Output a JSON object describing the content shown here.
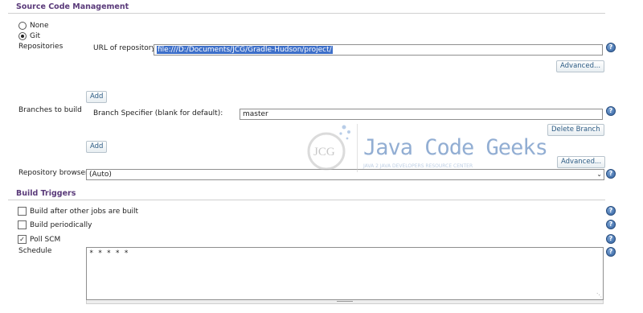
{
  "scm": {
    "title": "Source Code Management",
    "none_label": "None",
    "git_label": "Git",
    "repositories_label": "Repositories",
    "url_label": "URL of repository",
    "url_value": "file:///D:/Documents/JCG/Gradle-Hudson/project/",
    "advanced_label": "Advanced...",
    "add_label": "Add",
    "branches_label": "Branches to build",
    "branch_specifier_label": "Branch Specifier (blank for default):",
    "branch_value": "master",
    "delete_branch_label": "Delete Branch",
    "add_branch_label": "Add",
    "advanced2_label": "Advanced...",
    "repo_browser_label": "Repository browser",
    "repo_browser_value": "(Auto)"
  },
  "triggers": {
    "title": "Build Triggers",
    "after_jobs_label": "Build after other jobs are built",
    "periodically_label": "Build periodically",
    "poll_scm_label": "Poll SCM",
    "schedule_label": "Schedule",
    "schedule_value": "* * * * *"
  },
  "watermark": {
    "logo_text": "JCG",
    "title": "Java Code Geeks",
    "subtitle": "JAVA 2 JAVA DEVELOPERS RESOURCE CENTER"
  },
  "help_glyph": "?",
  "colors": {
    "section_title": "#5a3a7a",
    "link": "#2c5b84",
    "selection": "#3d6fc9",
    "help": "#2e5f9e"
  }
}
